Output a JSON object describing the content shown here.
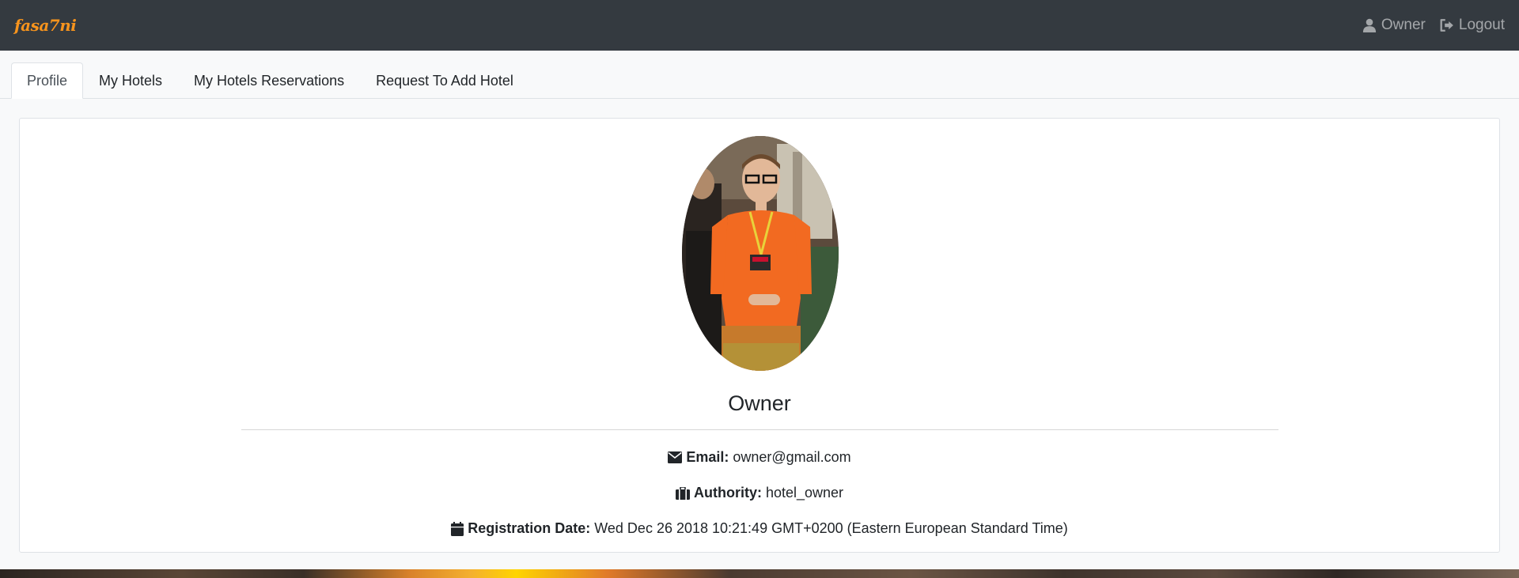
{
  "navbar": {
    "brand": "fasa7ni",
    "user_label": "Owner",
    "logout_label": "Logout"
  },
  "tabs": [
    {
      "label": "Profile",
      "active": true
    },
    {
      "label": "My Hotels",
      "active": false
    },
    {
      "label": "My Hotels Reservations",
      "active": false
    },
    {
      "label": "Request To Add Hotel",
      "active": false
    }
  ],
  "profile": {
    "name": "Owner",
    "email_label": "Email:",
    "email": "owner@gmail.com",
    "authority_label": "Authority:",
    "authority": "hotel_owner",
    "registration_label": "Registration Date:",
    "registration_date": "Wed Dec 26 2018 10:21:49 GMT+0200 (Eastern European Standard Time)"
  },
  "icons": {
    "user": "user-icon",
    "logout": "sign-out-icon",
    "email": "envelope-icon",
    "authority": "briefcase-icon",
    "registration": "calendar-icon"
  },
  "colors": {
    "navbar_bg": "#343a40",
    "brand": "#f7941d",
    "shirt": "#f26a21"
  }
}
